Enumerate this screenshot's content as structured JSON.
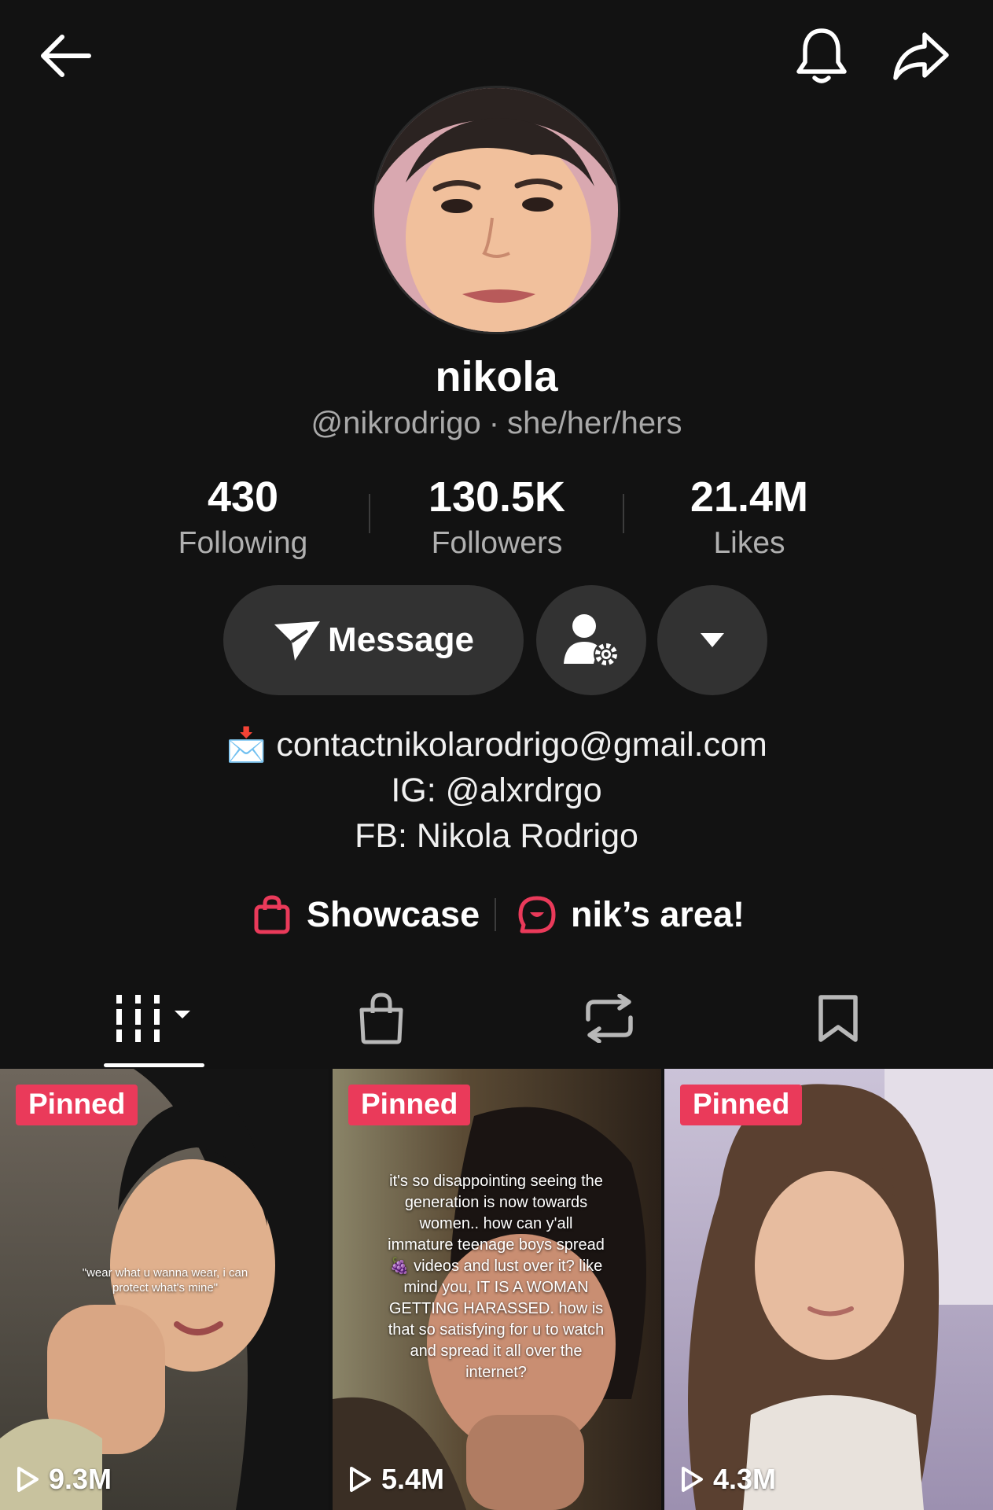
{
  "icons": {
    "back": "arrow-left-icon",
    "notifications": "bell-icon",
    "share": "share-arrow-icon",
    "message": "send-plane-icon",
    "friend_settings": "person-gear-icon",
    "more": "caret-down-icon",
    "email": "envelope-inbox-icon",
    "showcase": "shopping-bag-icon",
    "community": "chat-bubble-icon",
    "play": "play-outline-icon"
  },
  "profile": {
    "display_name": "nikola",
    "username": "@nikrodrigo",
    "separator": "·",
    "pronouns": "she/her/hers"
  },
  "stats": [
    {
      "value": "430",
      "label": "Following"
    },
    {
      "value": "130.5K",
      "label": "Followers"
    },
    {
      "value": "21.4M",
      "label": "Likes"
    }
  ],
  "actions": {
    "message_label": "Message"
  },
  "bio": {
    "emoji": "📩",
    "email": "contactnikolarodrigo@gmail.com",
    "ig": "IG: @alxrdrgo",
    "fb": "FB: Nikola Rodrigo"
  },
  "links": {
    "showcase": "Showcase",
    "community": "nik’s area!"
  },
  "tabs": [
    {
      "name": "videos",
      "icon": "grid-lines-icon",
      "active": true
    },
    {
      "name": "shop",
      "icon": "shopping-bag-icon",
      "active": false
    },
    {
      "name": "reposts",
      "icon": "repost-icon",
      "active": false
    },
    {
      "name": "favorites",
      "icon": "bookmark-icon",
      "active": false
    }
  ],
  "videos": [
    {
      "badge": "Pinned",
      "views": "9.3M",
      "caption": "\"wear what u wanna wear, i can protect what's mine\""
    },
    {
      "badge": "Pinned",
      "views": "5.4M",
      "caption": "it's so disappointing seeing the generation is now towards women.. how can y'all immature teenage boys spread 🍇 videos and lust over it? like mind you, IT IS A WOMAN GETTING HARASSED. how is that so satisfying for u to watch and spread it all over the internet?"
    },
    {
      "badge": "Pinned",
      "views": "4.3M",
      "caption": ""
    }
  ],
  "colors": {
    "background": "#121212",
    "button": "#323232",
    "accent": "#ea3a5a",
    "muted": "#a9a9a9"
  }
}
